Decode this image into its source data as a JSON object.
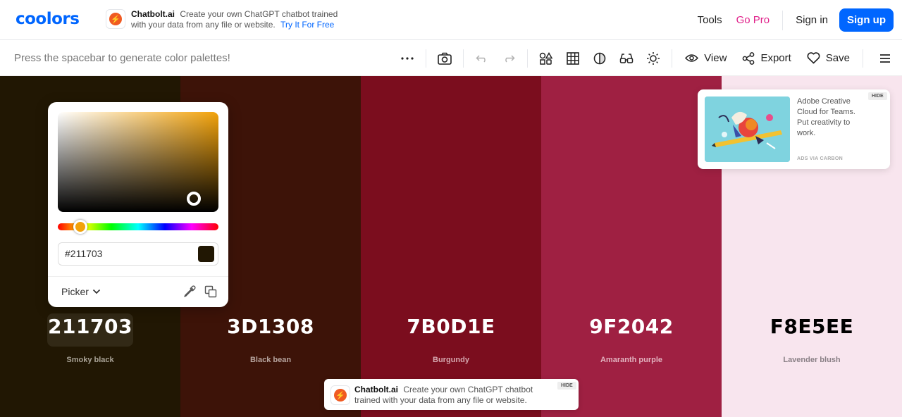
{
  "header": {
    "logo": "coolors",
    "promo": {
      "brand": "Chatbolt.ai",
      "text": "Create your own ChatGPT chatbot trained with your data from any file or website.",
      "cta": "Try It For Free"
    },
    "nav": {
      "tools": "Tools",
      "go_pro": "Go Pro",
      "sign_in": "Sign in",
      "sign_up": "Sign up"
    }
  },
  "toolbar": {
    "hint": "Press the spacebar to generate color palettes!",
    "view_label": "View",
    "export_label": "Export",
    "save_label": "Save"
  },
  "palette": [
    {
      "hex": "211703",
      "name": "Smoky black",
      "bg": "#211703",
      "fg": "#ffffff",
      "sub": "#a9a397"
    },
    {
      "hex": "3D1308",
      "name": "Black bean",
      "bg": "#3D1308",
      "fg": "#ffffff",
      "sub": "#b8a6a0"
    },
    {
      "hex": "7B0D1E",
      "name": "Burgundy",
      "bg": "#7B0D1E",
      "fg": "#ffffff",
      "sub": "#d6a9b0"
    },
    {
      "hex": "9F2042",
      "name": "Amaranth purple",
      "bg": "#9F2042",
      "fg": "#ffffff",
      "sub": "#e2b2bf"
    },
    {
      "hex": "F8E5EE",
      "name": "Lavender blush",
      "bg": "#F8E5EE",
      "fg": "#000000",
      "sub": "#8a8086"
    }
  ],
  "picker": {
    "hex_value": "#211703",
    "mode_label": "Picker",
    "chip_color": "#211703"
  },
  "carbon_ad": {
    "text": "Adobe Creative Cloud for Teams. Put creativity to work.",
    "via": "ADS VIA CARBON",
    "hide": "HIDE"
  },
  "bottom_promo": {
    "brand": "Chatbolt.ai",
    "text": "Create your own ChatGPT chatbot trained with your data from any file or website.",
    "hide": "HIDE"
  },
  "colors": {
    "accent": "#0066ff",
    "pro": "#e0218a",
    "promo_icon": "#f05a22"
  }
}
